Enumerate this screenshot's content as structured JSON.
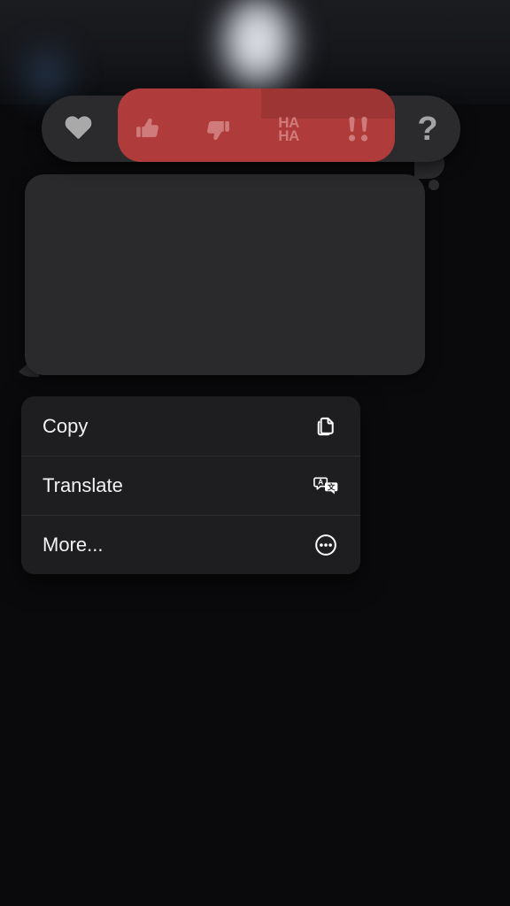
{
  "app": {
    "name": "Messages",
    "theme": "dark",
    "background_color": "#0a0a0c"
  },
  "colors": {
    "reaction_highlight": "#b03b3b",
    "tapback_bar": "#2b2b2d",
    "bubble": "#2a2a2c",
    "menu": "#1e1e20",
    "menu_divider": "#2e2e31",
    "menu_text": "#f2f2f4",
    "inactive_glyph": "#a9a9aa",
    "highlight_glyph": "#cf7b7b"
  },
  "tapback_bar": {
    "name": "tapback-reaction-bar",
    "highlighted_range": "thumbsup-to-exclamation",
    "reactions": [
      {
        "id": "heart",
        "label": "Heart",
        "glyph": "heart-icon",
        "selected": false
      },
      {
        "id": "thumbsup",
        "label": "Thumbs Up",
        "glyph": "thumbs-up-icon",
        "selected": true
      },
      {
        "id": "thumbsdown",
        "label": "Thumbs Down",
        "glyph": "thumbs-down-icon",
        "selected": true
      },
      {
        "id": "haha",
        "label": "HA HA",
        "glyph": "haha-text",
        "selected": true,
        "text_line_1": "HA",
        "text_line_2": "HA"
      },
      {
        "id": "exclaim",
        "label": "Double Exclamation",
        "glyph": "exclamation-icon",
        "selected": true
      },
      {
        "id": "question",
        "label": "Question Mark",
        "glyph": "question-mark-icon",
        "selected": false,
        "text": "?"
      }
    ]
  },
  "message": {
    "name": "message-bubble",
    "sender": "incoming",
    "text": "",
    "has_tail": true
  },
  "context_menu": {
    "name": "message-context-menu",
    "items": [
      {
        "label": "Copy",
        "icon": "copy-icon"
      },
      {
        "label": "Translate",
        "icon": "translate-icon"
      },
      {
        "label": "More...",
        "icon": "ellipsis-circle-icon"
      }
    ]
  },
  "backdrop": {
    "avatar_glow": "blurred-avatar",
    "side_glow": "blurred-blue-glow"
  }
}
